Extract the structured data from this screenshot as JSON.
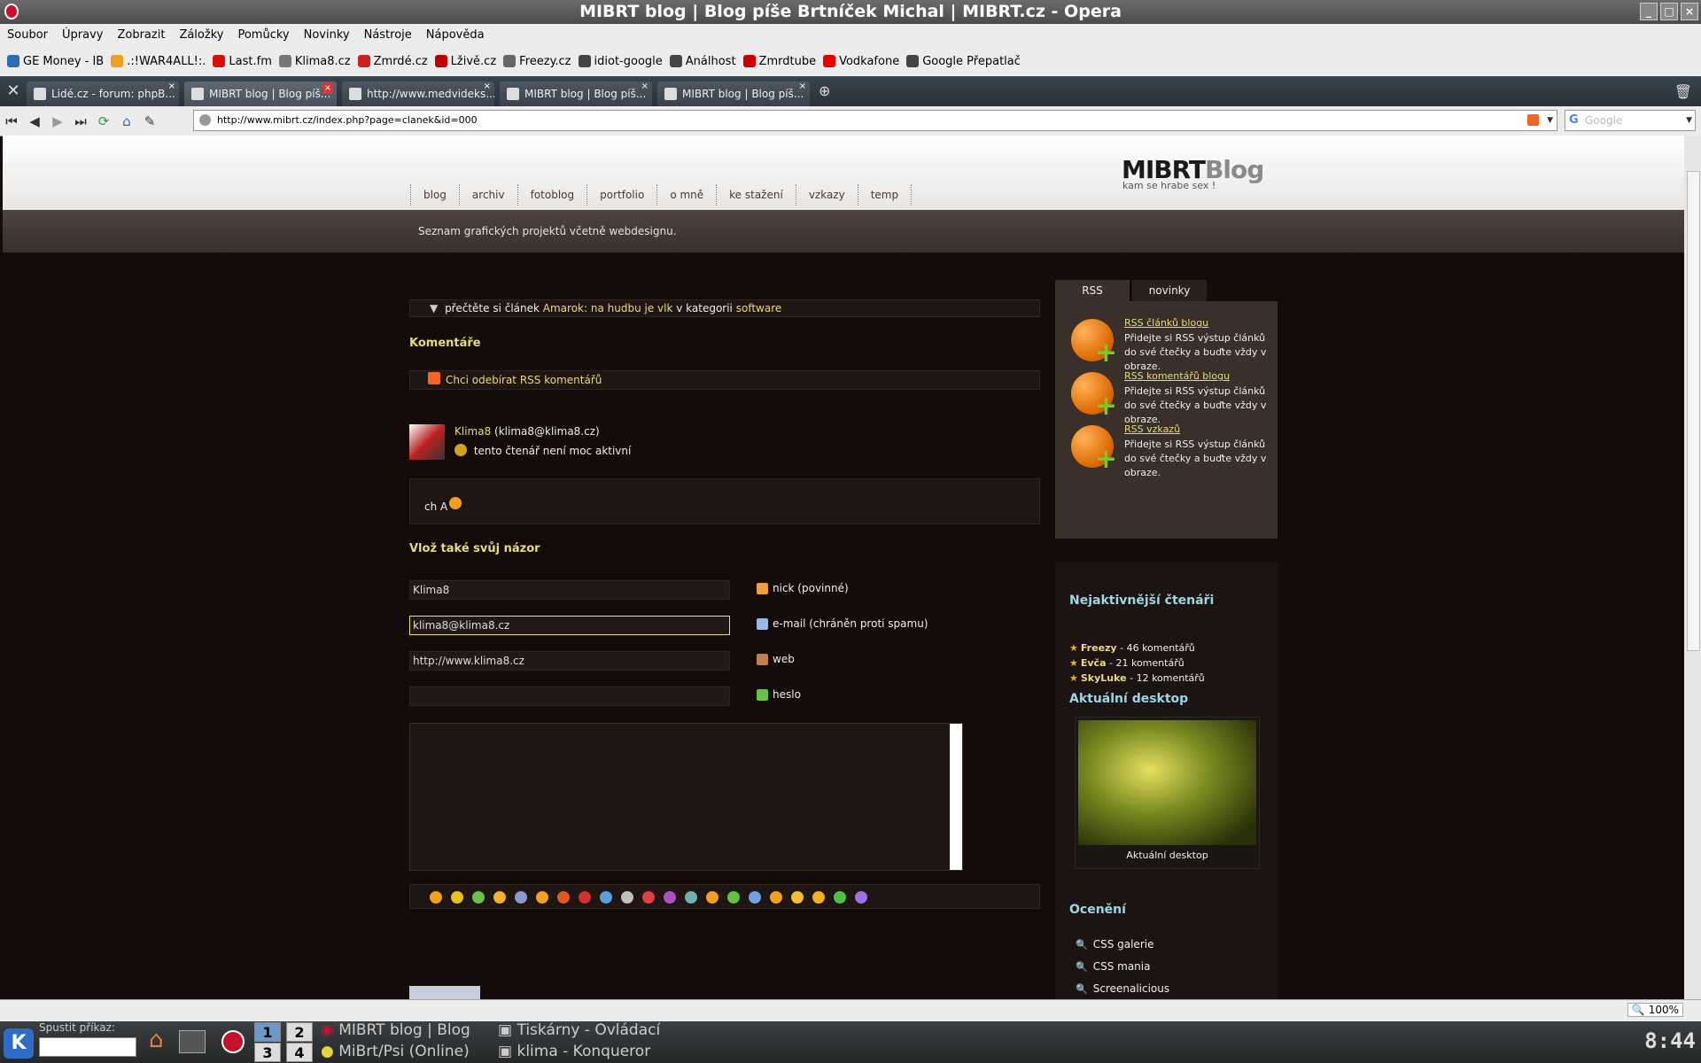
{
  "window": {
    "title": "MIBRT blog | Blog píše Brtníček Michal | MIBRT.cz - Opera"
  },
  "menu": [
    "Soubor",
    "Úpravy",
    "Zobrazit",
    "Záložky",
    "Pomůcky",
    "Novinky",
    "Nástroje",
    "Nápověda"
  ],
  "bookmarks": [
    {
      "label": "GE Money - IB",
      "color": "#2a6db0"
    },
    {
      "label": ".:!WAR4ALL!:.",
      "color": "#f0a020"
    },
    {
      "label": "Last.fm",
      "color": "#d51007"
    },
    {
      "label": "Klima8.cz",
      "color": "#777777"
    },
    {
      "label": "Zmrdé.cz",
      "color": "#cc2222"
    },
    {
      "label": "Lživě.cz",
      "color": "#c00000"
    },
    {
      "label": "Freezy.cz",
      "color": "#666666"
    },
    {
      "label": "idiot-google",
      "color": "#444444"
    },
    {
      "label": "Análhost",
      "color": "#444444"
    },
    {
      "label": "Zmrdtube",
      "color": "#cc0000"
    },
    {
      "label": "Vodkafone",
      "color": "#e60000"
    },
    {
      "label": "Google Přepatlač",
      "color": "#444444"
    }
  ],
  "tabs": [
    {
      "label": "Lidé.cz - forum: phpB...",
      "active": false
    },
    {
      "label": "MIBRT blog | Blog píš...",
      "active": true
    },
    {
      "label": "http://www.medvideks...",
      "active": false
    },
    {
      "label": "MIBRT blog | Blog píš...",
      "active": false
    },
    {
      "label": "MIBRT blog | Blog píš...",
      "active": false
    }
  ],
  "address": {
    "url": "http://www.mibrt.cz/index.php?page=clanek&id=000",
    "search_placeholder": "Google"
  },
  "site": {
    "logo_main": "MIBRT",
    "logo_blog": "Blog",
    "tagline": "kam se hrabe sex !",
    "nav": [
      "blog",
      "archiv",
      "fotoblog",
      "portfolio",
      "o mně",
      "ke stažení",
      "vzkazy",
      "temp"
    ],
    "subtitle": "Seznam grafických projektů včetně webdesignu."
  },
  "article": {
    "read_prefix": "přečtěte si článek",
    "read_title": "Amarok: na hudbu je vlk",
    "read_mid": "v kategorii",
    "read_cat": "software",
    "comments_heading": "Komentáře",
    "rss_comments": "Chci odebírat RSS komentářů",
    "comment": {
      "author": "Klima8",
      "email": "(klima8@klima8.cz)",
      "status": "tento čtenář není moc aktivní",
      "text": "ch A"
    },
    "form_heading": "Vlož také svůj názor",
    "form": {
      "nick_value": "Klima8",
      "nick_label": "nick (povinné)",
      "email_value": "klima8@klima8.cz",
      "email_label": "e-mail (chráněn proti spamu)",
      "web_value": "http://www.klima8.cz",
      "web_label": "web",
      "pass_value": "",
      "pass_label": "heslo"
    }
  },
  "sidebar": {
    "tabs": [
      "RSS",
      "novinky"
    ],
    "rss_items": [
      {
        "title": "RSS článků blogu",
        "desc": "Přidejte si RSS výstup článků do své čtečky a buďte vždy v obraze."
      },
      {
        "title": "RSS komentářů blogu",
        "desc": "Přidejte si RSS výstup článků do své čtečky a buďte vždy v obraze."
      },
      {
        "title": "RSS vzkazů",
        "desc": "Přidejte si RSS výstup článků do své čtečky a buďte vždy v obraze."
      }
    ],
    "readers_heading": "Nejaktivnější čtenáři",
    "readers": [
      {
        "name": "Freezy",
        "count": "- 46 komentářů"
      },
      {
        "name": "Evča",
        "count": "- 21 komentářů"
      },
      {
        "name": "SkyLuke",
        "count": "- 12 komentářů"
      }
    ],
    "desktop_heading": "Aktuální desktop",
    "desktop_caption": "Aktuální desktop",
    "awards_heading": "Ocenění",
    "awards": [
      "CSS galerie",
      "CSS mania",
      "Screenalicious"
    ]
  },
  "status": {
    "zoom": "100%"
  },
  "taskbar": {
    "run_label": "Spustit příkaz:",
    "pager": [
      "1",
      "2",
      "3",
      "4"
    ],
    "tasks": [
      "MIBRT blog | Blog",
      "Tiskárny - Ovládací",
      "MiBrt/Psi (Online)",
      "klima - Konqueror"
    ],
    "clock": "8:44"
  },
  "colors": {
    "accent_yellow": "#e8d982",
    "heading_cyan": "#9ad6e6",
    "page_bg": "#140c0a"
  }
}
